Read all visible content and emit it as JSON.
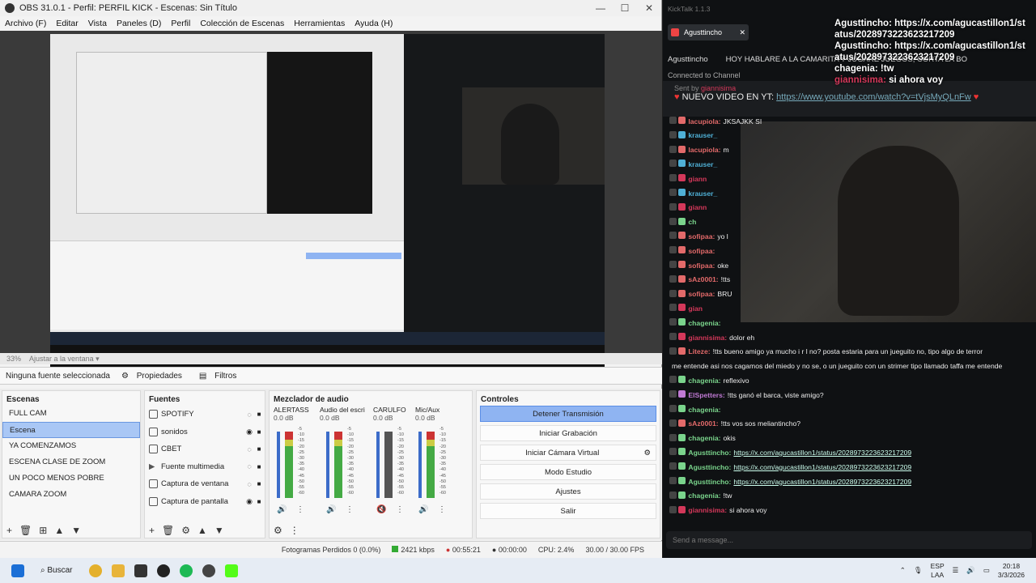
{
  "obs": {
    "title": "OBS 31.0.1 - Perfil: PERFIL KICK - Escenas: Sin Título",
    "menu": [
      "Archivo (F)",
      "Editar",
      "Vista",
      "Paneles (D)",
      "Perfil",
      "Colección de Escenas",
      "Herramientas",
      "Ayuda (H)"
    ],
    "zoom": "33%",
    "fit": "Ajustar a la ventana",
    "source_bar": {
      "none": "Ninguna fuente seleccionada",
      "props": "Propiedades",
      "filters": "Filtros"
    },
    "scenes": {
      "title": "Escenas",
      "items": [
        "FULL CAM",
        "Escena",
        "YA COMENZAMOS",
        "ESCENA CLASE DE ZOOM",
        "UN POCO MENOS POBRE",
        "CAMARA ZOOM"
      ],
      "selected": 1
    },
    "sources": {
      "title": "Fuentes",
      "items": [
        "SPOTIFY",
        "sonidos",
        "CBET",
        "Fuente multimedia",
        "Captura de ventana",
        "Captura de pantalla"
      ]
    },
    "mixer": {
      "title": "Mezclador de audio",
      "channels": [
        {
          "name": "ALERTASS",
          "db": "0.0 dB"
        },
        {
          "name": "Audio del escritorio",
          "db": "0.0 dB"
        },
        {
          "name": "CARULFO",
          "db": "0.0 dB"
        },
        {
          "name": "Mic/Aux",
          "db": "0.0 dB"
        }
      ],
      "scale": [
        "-5",
        "-10",
        "-15",
        "-20",
        "-25",
        "-30",
        "-35",
        "-40",
        "-45",
        "-50",
        "-55",
        "-60"
      ]
    },
    "controls": {
      "title": "Controles",
      "buttons": [
        "Detener Transmisión",
        "Iniciar Grabación",
        "Iniciar Cámara Virtual",
        "Modo Estudio",
        "Ajustes",
        "Salir"
      ]
    },
    "status": {
      "dropped": "Fotogramas Perdidos 0 (0.0%)",
      "kbps": "2421 kbps",
      "live": "00:55:21",
      "rec": "00:00:00",
      "cpu": "CPU: 2.4%",
      "fps": "30.00 / 30.00 FPS"
    }
  },
  "kick": {
    "app_title": "KickTalk 1.1.3",
    "tab": "Agusttincho",
    "channel": "Agusttincho",
    "stream_title": "HOY HABLARE A LA CAMARITA Y JUGARE JUEGOS, CORTA LA BO",
    "connected": "Connected to Channel",
    "pinned_sent_by": "Sent by",
    "pinned_sender": "giannisima",
    "pinned_text": "NUEVO VIDEO EN YT:",
    "pinned_link": "https://www.youtube.com/watch?v=tVjsMyQLnFw",
    "overlay": [
      {
        "user": "Agusttincho:",
        "text": "https://x.com/agucastillon1/status/2028973223623217209"
      },
      {
        "user": "Agusttincho:",
        "text": "https://x.com/agucastillon1/status/2028973223623217209"
      },
      {
        "user": "chagenia:",
        "text": "!tw"
      },
      {
        "user": "giannisima:",
        "text": "si ahora voy"
      }
    ],
    "chat": [
      {
        "user": "lacupiola:",
        "text": "JKSAJKK SI",
        "color": "#e36a6a"
      },
      {
        "user": "krauser_",
        "text": "",
        "color": "#4fb0d6"
      },
      {
        "user": "lacupiola:",
        "text": "m",
        "color": "#e36a6a"
      },
      {
        "user": "krauser_",
        "text": "",
        "color": "#4fb0d6"
      },
      {
        "user": "giann",
        "text": "",
        "color": "#d4385a"
      },
      {
        "user": "krauser_",
        "text": "",
        "color": "#4fb0d6"
      },
      {
        "user": "giann",
        "text": "",
        "color": "#d4385a"
      },
      {
        "user": "ch",
        "text": "",
        "color": "#7ad48c"
      },
      {
        "user": "sofipaa:",
        "text": "yo l",
        "color": "#e36a6a"
      },
      {
        "user": "sofipaa:",
        "text": "",
        "color": "#e36a6a"
      },
      {
        "user": "sofipaa:",
        "text": "oke",
        "color": "#e36a6a"
      },
      {
        "user": "sAz0001:",
        "text": "!tts",
        "color": "#e36a6a"
      },
      {
        "user": "sofipaa:",
        "text": "BRU",
        "color": "#e36a6a"
      },
      {
        "user": "gian",
        "text": "",
        "color": "#d4385a"
      },
      {
        "user": "chagenia:",
        "text": "",
        "color": "#7ad48c"
      },
      {
        "user": "giannisima:",
        "text": "dolor eh",
        "color": "#d4385a"
      },
      {
        "user": "Liteze:",
        "text": "!tts bueno amigo ya mucho i r l no? posta estaria para un jueguito no, tipo algo de terror",
        "color": "#e36a6a"
      },
      {
        "user": "",
        "text": "me entende asi nos cagamos del miedo y no se, o un jueguito con un strimer tipo llamado taffa me entende",
        "color": "#eee"
      },
      {
        "user": "chagenia:",
        "text": "reflexivo",
        "color": "#7ad48c"
      },
      {
        "user": "ElSpetters:",
        "text": "!tts ganó el barca, viste amigo?",
        "color": "#c07ad4"
      },
      {
        "user": "chagenia:",
        "text": "",
        "color": "#7ad48c"
      },
      {
        "user": "sAz0001:",
        "text": "!tts vos sos meliantincho?",
        "color": "#e36a6a"
      },
      {
        "user": "chagenia:",
        "text": "okis",
        "color": "#7ad48c"
      },
      {
        "user": "Agusttincho:",
        "text": "https://x.com/agucastillon1/status/2028973223623217209",
        "color": "#7ad48c"
      },
      {
        "user": "Agusttincho:",
        "text": "https://x.com/agucastillon1/status/2028973223623217209",
        "color": "#7ad48c"
      },
      {
        "user": "Agusttincho:",
        "text": "https://x.com/agucastillon1/status/2028973223623217209",
        "color": "#7ad48c"
      },
      {
        "user": "chagenia:",
        "text": "!tw",
        "color": "#7ad48c"
      },
      {
        "user": "giannisima:",
        "text": "si ahora voy",
        "color": "#d4385a"
      }
    ],
    "input_placeholder": "Send a message..."
  },
  "taskbar": {
    "search": "Buscar",
    "lang1": "ESP",
    "lang2": "LAA",
    "time": "20:18",
    "date": "3/3/2026"
  }
}
